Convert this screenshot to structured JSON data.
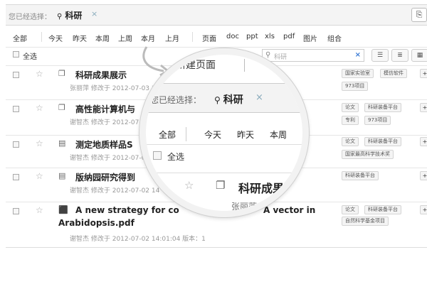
{
  "topbar": {
    "selected_label": "您已经选择：",
    "filter": "科研",
    "filter_icon": "search-icon",
    "close_glyph": "×",
    "new_icon": "new-page-icon"
  },
  "timebar": [
    "全部",
    "今天",
    "昨天",
    "本周",
    "上周",
    "本月",
    "上月",
    "页面",
    "doc",
    "ppt",
    "xls",
    "pdf",
    "图片",
    "组合"
  ],
  "selbar": {
    "select_all": "全选",
    "search_placeholder": "科研",
    "search_clear": "×",
    "view_icons": [
      "list-view-icon",
      "detail-view-icon",
      "grid-view-icon"
    ]
  },
  "rows": [
    {
      "icon": "page-icon",
      "title": "科研成果展示",
      "meta": "张丽萍 修改于 2012-07-03 10:",
      "tags": [
        "国家实验室",
        "模仿软件",
        "973项目"
      ]
    },
    {
      "icon": "page-icon",
      "title": "高性能计算机与",
      "meta": "谢智杰 修改于 2012-07-03",
      "tags": [
        "论文",
        "科研装备平台",
        "专利",
        "973项目"
      ]
    },
    {
      "icon": "doc-icon",
      "title": "测定地质样品S",
      "meta": "谢智杰 修改于 2012-07-03",
      "tags": [
        "论文",
        "科研装备平台",
        "国家最高科学技术奖"
      ]
    },
    {
      "icon": "doc-icon",
      "title": "版纳园研究得到",
      "meta": "谢智杰 修改于 2012-07-02 14",
      "tags": [
        "科研装备平台"
      ]
    },
    {
      "icon": "pdf-icon",
      "title": "A new strategy for co",
      "title2": "Arabidopsis.pdf",
      "title_tail": "A vector in",
      "meta": "谢智杰 修改于 2012-07-02 14:01:04    版本：1",
      "tags": [
        "论文",
        "科研装备平台",
        "自然科学基金项目"
      ]
    }
  ],
  "magnifier": {
    "new_page": "新建页面",
    "selected_label": "您已经选择：",
    "filter": "科研",
    "close_glyph": "×",
    "time": [
      "全部",
      "今天",
      "昨天",
      "本周"
    ],
    "select_all": "全选",
    "row_title": "科研成果",
    "row_meta": "张丽萍 修改"
  },
  "plus_label": "+"
}
